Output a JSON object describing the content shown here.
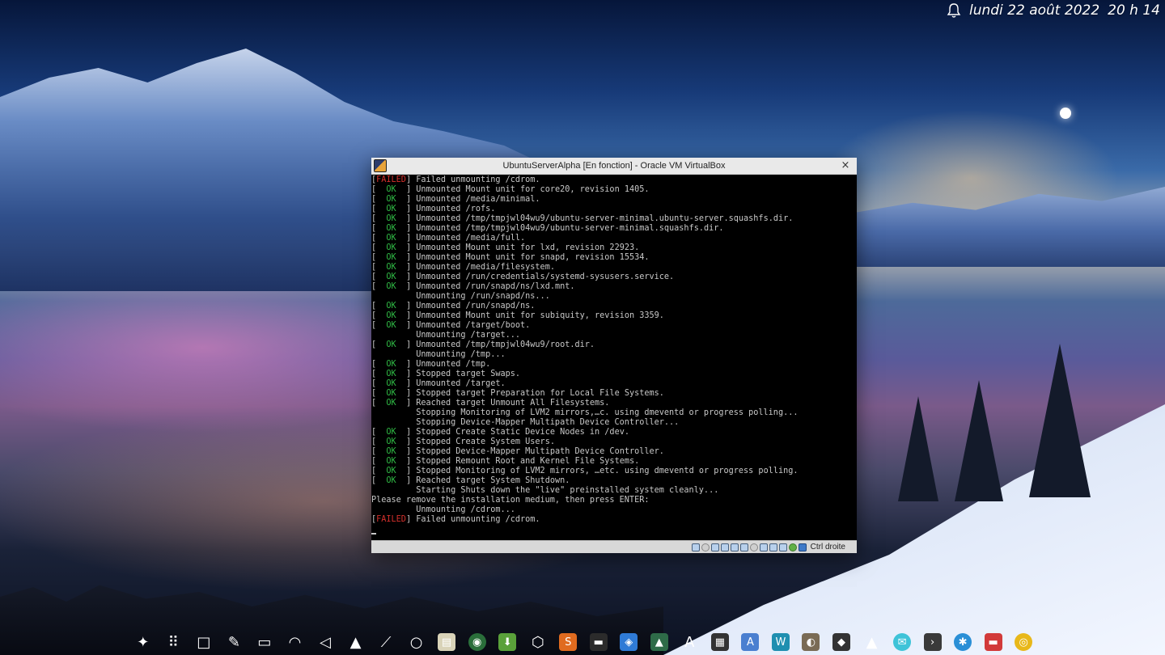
{
  "clock": {
    "date": "lundi 22 août 2022",
    "time": "20 h 14",
    "notification_icon": "bell-icon"
  },
  "vbox": {
    "title": "UbuntuServerAlpha [En fonction] - Oracle VM VirtualBox",
    "close_glyph": "×",
    "host_key_label": "Ctrl droite",
    "status_icons": [
      "hard-disk-icon",
      "optical-drive-icon",
      "audio-icon",
      "network-icon",
      "usb-icon",
      "shared-folders-icon",
      "display-icon",
      "video-capture-icon",
      "mouse-integration-icon",
      "virtualization-icon",
      "cpu-icon",
      "keyboard-icon"
    ]
  },
  "terminal": {
    "lines": [
      {
        "status": "FAILED",
        "text": " Failed unmounting /cdrom."
      },
      {
        "status": "OK",
        "text": " Unmounted Mount unit for core20, revision 1405."
      },
      {
        "status": "OK",
        "text": " Unmounted /media/minimal."
      },
      {
        "status": "OK",
        "text": " Unmounted /rofs."
      },
      {
        "status": "OK",
        "text": " Unmounted /tmp/tmpjwl04wu9/ubuntu-server-minimal.ubuntu-server.squashfs.dir."
      },
      {
        "status": "OK",
        "text": " Unmounted /tmp/tmpjwl04wu9/ubuntu-server-minimal.squashfs.dir."
      },
      {
        "status": "OK",
        "text": " Unmounted /media/full."
      },
      {
        "status": "OK",
        "text": " Unmounted Mount unit for lxd, revision 22923."
      },
      {
        "status": "OK",
        "text": " Unmounted Mount unit for snapd, revision 15534."
      },
      {
        "status": "OK",
        "text": " Unmounted /media/filesystem."
      },
      {
        "status": "OK",
        "text": " Unmounted /run/credentials/systemd-sysusers.service."
      },
      {
        "status": "OK",
        "text": " Unmounted /run/snapd/ns/lxd.mnt."
      },
      {
        "status": "",
        "text": "         Unmounting /run/snapd/ns..."
      },
      {
        "status": "OK",
        "text": " Unmounted /run/snapd/ns."
      },
      {
        "status": "OK",
        "text": " Unmounted Mount unit for subiquity, revision 3359."
      },
      {
        "status": "OK",
        "text": " Unmounted /target/boot."
      },
      {
        "status": "",
        "text": "         Unmounting /target..."
      },
      {
        "status": "OK",
        "text": " Unmounted /tmp/tmpjwl04wu9/root.dir."
      },
      {
        "status": "",
        "text": "         Unmounting /tmp..."
      },
      {
        "status": "OK",
        "text": " Unmounted /tmp."
      },
      {
        "status": "OK",
        "text": " Stopped target Swaps."
      },
      {
        "status": "OK",
        "text": " Unmounted /target."
      },
      {
        "status": "OK",
        "text": " Stopped target Preparation for Local File Systems."
      },
      {
        "status": "OK",
        "text": " Reached target Unmount All Filesystems."
      },
      {
        "status": "",
        "text": "         Stopping Monitoring of LVM2 mirrors,…c. using dmeventd or progress polling..."
      },
      {
        "status": "",
        "text": "         Stopping Device-Mapper Multipath Device Controller..."
      },
      {
        "status": "OK",
        "text": " Stopped Create Static Device Nodes in /dev."
      },
      {
        "status": "OK",
        "text": " Stopped Create System Users."
      },
      {
        "status": "OK",
        "text": " Stopped Device-Mapper Multipath Device Controller."
      },
      {
        "status": "OK",
        "text": " Stopped Remount Root and Kernel File Systems."
      },
      {
        "status": "OK",
        "text": " Stopped Monitoring of LVM2 mirrors, …etc. using dmeventd or progress polling."
      },
      {
        "status": "OK",
        "text": " Reached target System Shutdown."
      },
      {
        "status": "",
        "text": "         Starting Shuts down the \"live\" preinstalled system cleanly..."
      },
      {
        "status": "",
        "text": "Please remove the installation medium, then press ENTER:"
      },
      {
        "status": "",
        "text": "         Unmounting /cdrom..."
      },
      {
        "status": "FAILED",
        "text": " Failed unmounting /cdrom."
      }
    ]
  },
  "dock": {
    "items": [
      {
        "name": "app-launcher-icon",
        "glyph": "✦",
        "color": "transparent"
      },
      {
        "name": "app-grid-icon",
        "glyph": "⠿",
        "color": "transparent"
      },
      {
        "name": "show-desktop-icon",
        "glyph": "□",
        "color": "transparent"
      },
      {
        "name": "clipboard-icon",
        "glyph": "✎",
        "color": "transparent"
      },
      {
        "name": "battery-icon",
        "glyph": "▭",
        "color": "transparent"
      },
      {
        "name": "wifi-icon",
        "glyph": "◠",
        "color": "transparent"
      },
      {
        "name": "volume-icon",
        "glyph": "◁",
        "color": "transparent"
      },
      {
        "name": "expand-tray-icon",
        "glyph": "▲",
        "color": "transparent"
      },
      {
        "name": "color-picker-icon",
        "glyph": "⟋",
        "color": "transparent"
      },
      {
        "name": "workspace-circle-icon",
        "glyph": "○",
        "color": "transparent"
      },
      {
        "name": "notes-app-icon",
        "glyph": "▤",
        "color": "#d9d3b8"
      },
      {
        "name": "browser-globe-icon",
        "glyph": "◉",
        "color": "#2a6e3a"
      },
      {
        "name": "package-manager-icon",
        "glyph": "⬇",
        "color": "#5aa13a"
      },
      {
        "name": "virtualbox-icon",
        "glyph": "⬡",
        "color": "transparent"
      },
      {
        "name": "software-store-icon",
        "glyph": "S",
        "color": "#e06b1f"
      },
      {
        "name": "terminal-app-icon",
        "glyph": "▬",
        "color": "#2b2b2b"
      },
      {
        "name": "shopping-bag-icon",
        "glyph": "◈",
        "color": "#2f7bd6"
      },
      {
        "name": "system-monitor-icon",
        "glyph": "▲",
        "color": "#2e6b48"
      },
      {
        "name": "font-viewer-icon",
        "glyph": "A",
        "color": "transparent"
      },
      {
        "name": "calculator-icon",
        "glyph": "▦",
        "color": "#333333"
      },
      {
        "name": "text-editor-icon",
        "glyph": "A",
        "color": "#4a7fd0"
      },
      {
        "name": "writer-icon",
        "glyph": "W",
        "color": "#1f8fb0"
      },
      {
        "name": "gimp-icon",
        "glyph": "◐",
        "color": "#7a6b55"
      },
      {
        "name": "inkscape-icon",
        "glyph": "◆",
        "color": "#333333"
      },
      {
        "name": "vlc-icon",
        "glyph": "▲",
        "color": "transparent"
      },
      {
        "name": "mail-icon",
        "glyph": "✉",
        "color": "#3ec3d8"
      },
      {
        "name": "console-icon",
        "glyph": "›",
        "color": "#3a3a3a"
      },
      {
        "name": "bluetooth-file-icon",
        "glyph": "✱",
        "color": "#2a8fd6"
      },
      {
        "name": "file-manager-icon",
        "glyph": "▬",
        "color": "#d23a3a"
      },
      {
        "name": "chrome-icon",
        "glyph": "◎",
        "color": "#e8b81a"
      }
    ]
  }
}
